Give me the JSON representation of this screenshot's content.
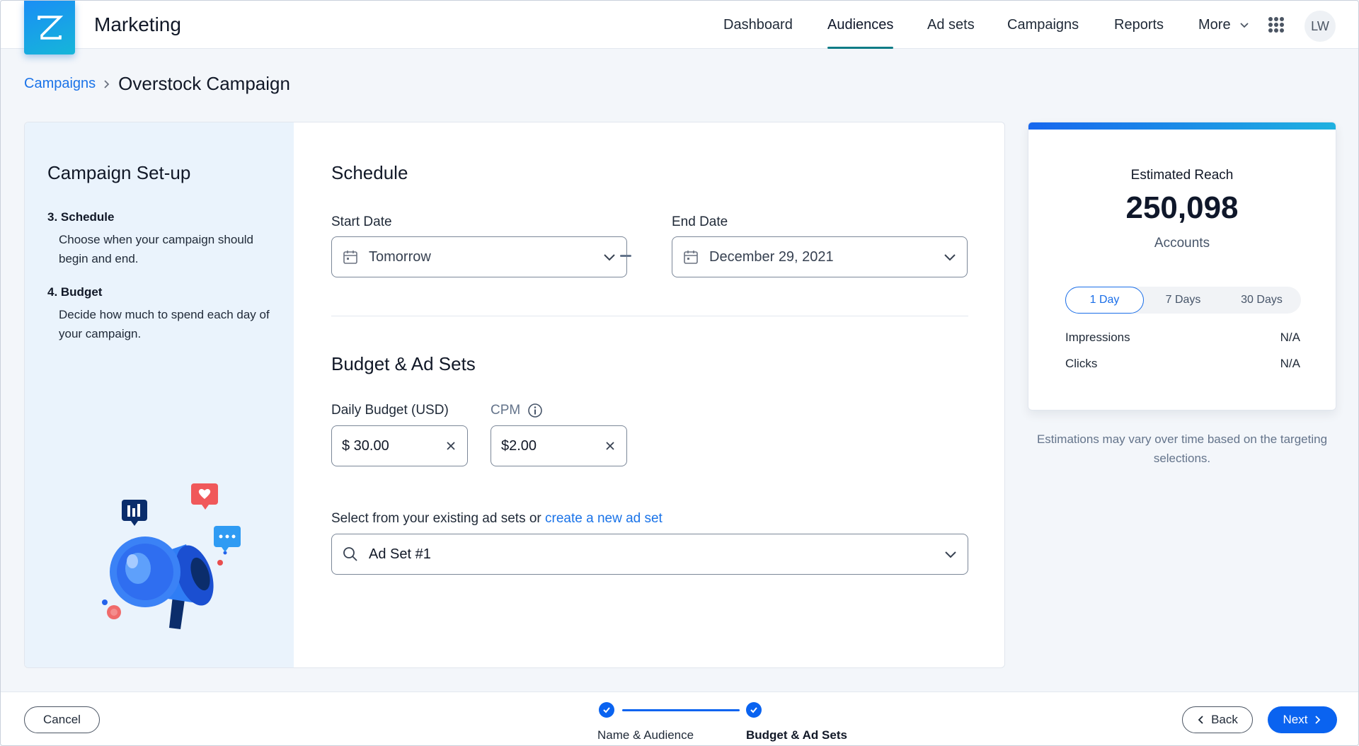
{
  "app": {
    "title": "Marketing",
    "logo_letter": "Z"
  },
  "nav": {
    "items": [
      {
        "label": "Dashboard"
      },
      {
        "label": "Audiences",
        "active": true
      },
      {
        "label": "Ad sets"
      },
      {
        "label": "Campaigns"
      },
      {
        "label": "Reports"
      },
      {
        "label": "More"
      }
    ],
    "avatar": "LW"
  },
  "breadcrumb": {
    "parent": "Campaigns",
    "current": "Overstock Campaign"
  },
  "sidebar": {
    "title": "Campaign Set-up",
    "steps": [
      {
        "title": "3. Schedule",
        "desc": "Choose when your campaign should begin and end."
      },
      {
        "title": "4. Budget",
        "desc": "Decide how much to spend each day of your campaign."
      }
    ]
  },
  "schedule": {
    "title": "Schedule",
    "start_label": "Start Date",
    "start_value": "Tomorrow",
    "end_label": "End Date",
    "end_value": "December 29, 2021"
  },
  "budget": {
    "title": "Budget & Ad Sets",
    "daily_label": "Daily Budget  (USD)",
    "daily_value": "$ 30.00",
    "cpm_label": "CPM",
    "cpm_value": "$2.00",
    "adset_prompt": "Select from your existing ad sets or ",
    "adset_link": "create a new ad set",
    "adset_value": "Ad Set #1"
  },
  "reach": {
    "title": "Estimated Reach",
    "number": "250,098",
    "unit": "Accounts",
    "ranges": [
      "1 Day",
      "7 Days",
      "30 Days"
    ],
    "active_range": "1 Day",
    "metrics": [
      {
        "label": "Impressions",
        "value": "N/A"
      },
      {
        "label": "Clicks",
        "value": "N/A"
      }
    ],
    "note": "Estimations may vary over time based on the targeting selections."
  },
  "footer": {
    "cancel": "Cancel",
    "steps": [
      "Name & Audience",
      "Budget & Ad Sets"
    ],
    "back": "Back",
    "next": "Next"
  },
  "colors": {
    "accent": "#0a63f0",
    "link": "#1a73e8",
    "nav_underline": "#0e7c86",
    "sidebar_bg": "#eaf3fc"
  }
}
